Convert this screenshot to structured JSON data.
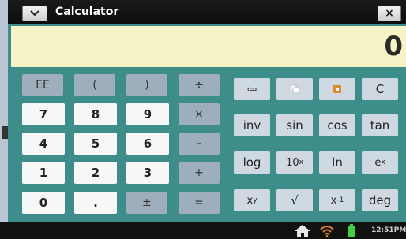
{
  "window": {
    "title": "Calculator",
    "close_label": "×"
  },
  "display": {
    "value": "0"
  },
  "keypad": {
    "row1": [
      "EE",
      "(",
      ")",
      "÷"
    ],
    "row2": [
      "7",
      "8",
      "9",
      "×"
    ],
    "row3": [
      "4",
      "5",
      "6",
      "-"
    ],
    "row4": [
      "1",
      "2",
      "3",
      "+"
    ],
    "row5": [
      "0",
      ".",
      "±",
      "="
    ]
  },
  "functions": {
    "backspace": "⇦",
    "clear": "C",
    "inv": "inv",
    "sin": "sin",
    "cos": "cos",
    "tan": "tan",
    "log": "log",
    "ten_base": "10",
    "ten_exp": "x",
    "ln": "ln",
    "e_base": "e",
    "e_exp": "x",
    "xy_base": "x",
    "xy_exp": "y",
    "sqrt": "√",
    "inverse_base": "x",
    "inverse_exp": "-1",
    "deg": "deg"
  },
  "taskbar": {
    "clock": "12:51PM"
  },
  "colors": {
    "window_bg": "#3d8e8a",
    "display_bg": "#f6f4c7",
    "number_key": "#f7f7f7",
    "operator_key": "#9eaebc",
    "function_key": "#cfd9e1"
  }
}
